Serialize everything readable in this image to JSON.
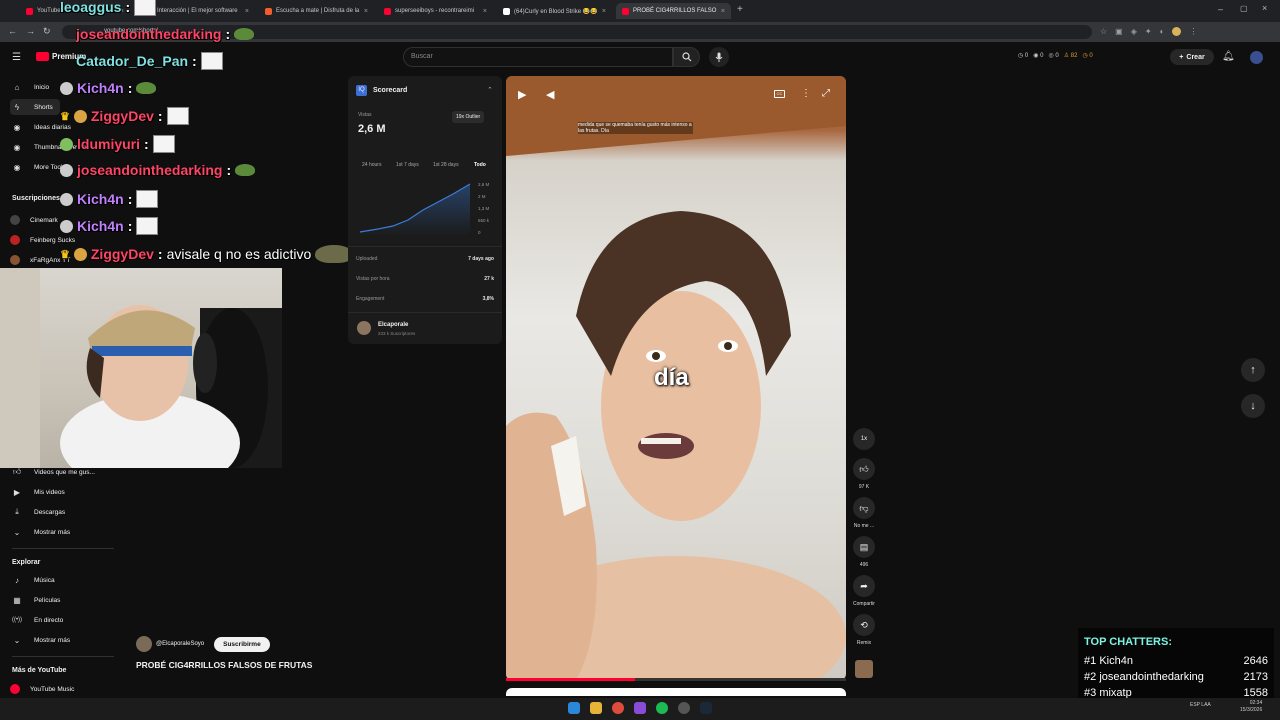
{
  "browser": {
    "tabs": [
      {
        "title": "YouTube",
        "color": "#ff0033"
      },
      {
        "title": "Interacción | El mejor software",
        "color": "#5b8dee"
      },
      {
        "title": "Escucha a mate | Disfruta de la",
        "color": "#f55c2b"
      },
      {
        "title": "superseeiboys - recontrareimi",
        "color": "#ff0033"
      },
      {
        "title": "(64)Curly en Blood Strike 😂😂",
        "color": "#000000"
      },
      {
        "title": "PROBÉ CIG4RRILLOS FALSO",
        "color": "#ff0033"
      }
    ],
    "url": "youtube.com/shorts/..."
  },
  "youtube": {
    "search_placeholder": "Buscar",
    "create_label": "Crear",
    "logo_text": "Premium",
    "ext_stats": [
      "0",
      "0",
      "0",
      "82",
      "0"
    ]
  },
  "sidebar": {
    "main": [
      {
        "label": "Inicio",
        "icon": "home-icon",
        "glyph": "⌂"
      },
      {
        "label": "Shorts",
        "icon": "shorts-icon",
        "glyph": "ϟ"
      },
      {
        "label": "Ideas diarias",
        "icon": "bulb-icon",
        "glyph": "◉"
      },
      {
        "label": "Thumbnail Preview",
        "icon": "preview-icon",
        "glyph": "◉"
      },
      {
        "label": "More Tools",
        "icon": "tools-icon",
        "glyph": "◉"
      }
    ],
    "subscriptions_title": "Suscripciones",
    "subscriptions": [
      {
        "label": "Cinemark",
        "color": "#444"
      },
      {
        "label": "Feinberg Sucks",
        "color": "#b22"
      },
      {
        "label": "xFaRgAnx YT",
        "color": "#885533"
      }
    ],
    "you": [
      {
        "label": "Videos que me gus...",
        "icon": "like-icon",
        "glyph": "👍"
      },
      {
        "label": "Mis videos",
        "icon": "play-square-icon",
        "glyph": "▶"
      },
      {
        "label": "Descargas",
        "icon": "download-icon",
        "glyph": "⤓"
      },
      {
        "label": "Mostrar más",
        "icon": "chevron-down-icon",
        "glyph": "⌄"
      }
    ],
    "explore_title": "Explorar",
    "explore": [
      {
        "label": "Música",
        "icon": "music-icon",
        "glyph": "♪"
      },
      {
        "label": "Películas",
        "icon": "film-icon",
        "glyph": "▦"
      },
      {
        "label": "En directo",
        "icon": "live-icon",
        "glyph": "((•))"
      },
      {
        "label": "Mostrar más",
        "icon": "chevron-down-icon",
        "glyph": "⌄"
      }
    ],
    "more_title": "Más de YouTube",
    "more": [
      {
        "label": "YouTube Music",
        "icon": "youtube-music-icon"
      }
    ]
  },
  "chat": [
    {
      "user": "leoaggus",
      "color": "#80e0e0",
      "msg": "",
      "emote": "pepe"
    },
    {
      "user": "joseandointhedarking",
      "color": "#ff4466",
      "msg": "",
      "emote": "frog"
    },
    {
      "user": "Catador_De_Pan",
      "color": "#80e0e0",
      "msg": "",
      "emote": "pepe"
    },
    {
      "user": "Kich4n",
      "color": "#c080ff",
      "msg": "",
      "emote": "frog"
    },
    {
      "user": "ZiggyDev",
      "color": "#ff4466",
      "msg": "",
      "emote": "pepe"
    },
    {
      "user": "ldumiyuri",
      "color": "#ff4466",
      "msg": "",
      "emote": "pepe"
    },
    {
      "user": "joseandointhedarking",
      "color": "#ff4466",
      "msg": "",
      "emote": "frog"
    },
    {
      "user": "Kich4n",
      "color": "#c080ff",
      "msg": "",
      "emote": "pepe"
    },
    {
      "user": "Kich4n",
      "color": "#c080ff",
      "msg": "",
      "emote": "pepe"
    },
    {
      "user": "ZiggyDev",
      "color": "#ff4466",
      "msg": "avisale q no es adictivo",
      "emote": "frog"
    }
  ],
  "scorecard": {
    "title": "Scorecard",
    "views_label": "Vistas",
    "views_value": "2,6 M",
    "outlier": "19x Outlier",
    "timeframes": [
      "24 hours",
      "1st 7 days",
      "1st 28 days",
      "Todo"
    ],
    "y_ticks": [
      "2,6 M",
      "2 M",
      "1,3 M",
      "650 k",
      "0"
    ],
    "rows": [
      {
        "label": "Uploaded",
        "value": "7 days ago"
      },
      {
        "label": "Vistas por hora",
        "value": "27 k"
      },
      {
        "label": "Engagement",
        "value": "3,8%"
      }
    ],
    "channel_name": "Elcaporale",
    "channel_subs": "233 k Suscriptores"
  },
  "video": {
    "caption_small": "medida que se quemaba tenía gusto más intenso a las frutas. Día",
    "caption_big": "día",
    "progress": 0.38,
    "channel": "@ElcaporaleSoyo",
    "subscribe_label": "Suscribirme",
    "title": "PROBÉ CIG4RRILLOS FALSOS DE FRUTAS"
  },
  "actions": {
    "speed": "1x",
    "likes": "97 K",
    "dislike": "No me ...",
    "comments": "496",
    "share": "Compartir",
    "remix": "Remix"
  },
  "top_chatters": {
    "title": "TOP CHATTERS:",
    "rows": [
      {
        "rank": "#1",
        "name": "Kich4n",
        "count": "2646"
      },
      {
        "rank": "#2",
        "name": "joseandointhedarking",
        "count": "2173"
      },
      {
        "rank": "#3",
        "name": "mixatp",
        "count": "1558"
      }
    ]
  },
  "taskbar": {
    "lang": "ESP LAA",
    "time": "02:34",
    "date": "15/3/2026"
  }
}
